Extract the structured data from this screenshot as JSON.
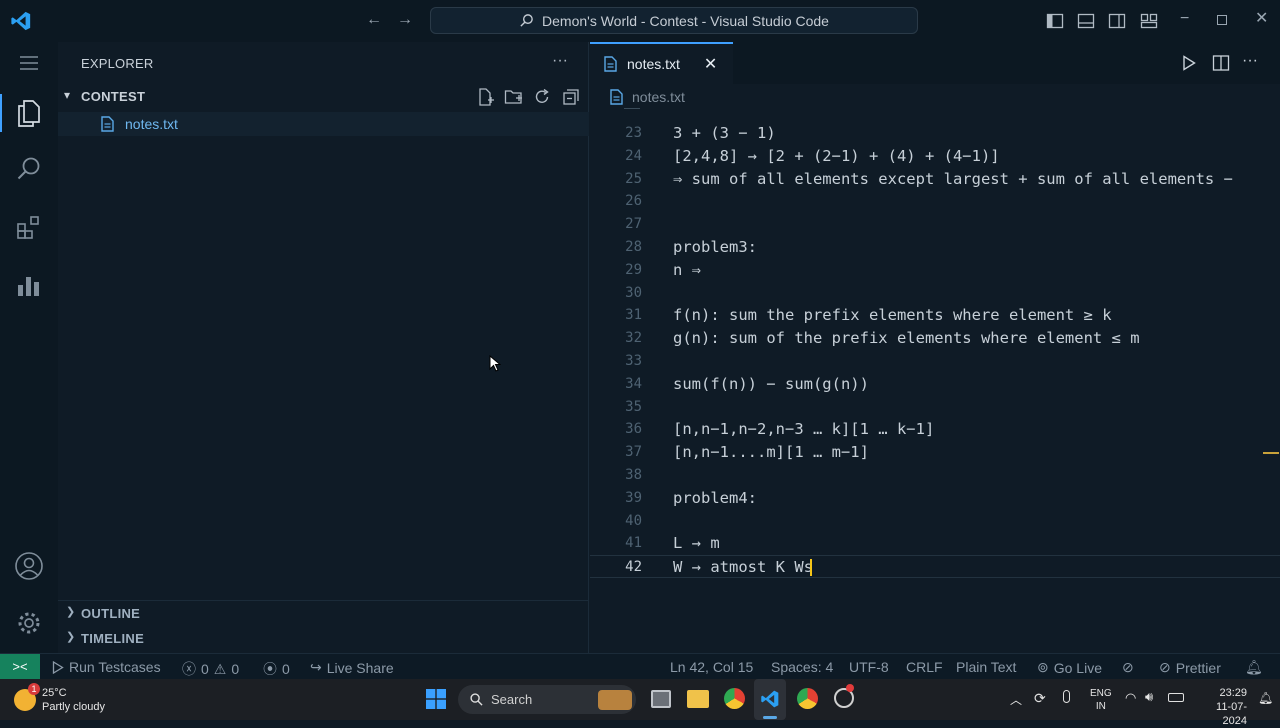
{
  "titlebar": {
    "title": "Demon's World - Contest - Visual Studio Code"
  },
  "sidebar": {
    "title": "EXPLORER",
    "more": "···",
    "folder": "CONTEST",
    "files": [
      {
        "name": "notes.txt"
      }
    ],
    "outline": "OUTLINE",
    "timeline": "TIMELINE"
  },
  "editor": {
    "tab_label": "notes.txt",
    "breadcrumb": "notes.txt",
    "lines": [
      {
        "n": "23",
        "text": "3 + (3 − 1)"
      },
      {
        "n": "24",
        "text": "[2,4,8] → [2 + (2−1) + (4) + (4−1)]"
      },
      {
        "n": "25",
        "text": "⇒ sum of all elements except largest + sum of all elements −"
      },
      {
        "n": "26",
        "text": ""
      },
      {
        "n": "27",
        "text": ""
      },
      {
        "n": "28",
        "text": "problem3:"
      },
      {
        "n": "29",
        "text": "n ⇒"
      },
      {
        "n": "30",
        "text": ""
      },
      {
        "n": "31",
        "text": "f(n): sum the prefix elements where element ≥ k"
      },
      {
        "n": "32",
        "text": "g(n): sum of the prefix elements where element ≤ m"
      },
      {
        "n": "33",
        "text": ""
      },
      {
        "n": "34",
        "text": "sum(f(n)) − sum(g(n))"
      },
      {
        "n": "35",
        "text": ""
      },
      {
        "n": "36",
        "text": "[n,n−1,n−2,n−3 … k][1 … k−1]"
      },
      {
        "n": "37",
        "text": "[n,n−1....m][1 … m−1]"
      },
      {
        "n": "38",
        "text": ""
      },
      {
        "n": "39",
        "text": "problem4:"
      },
      {
        "n": "40",
        "text": ""
      },
      {
        "n": "41",
        "text": "L → m"
      },
      {
        "n": "42",
        "text": "W → atmost K Ws"
      }
    ],
    "current_line": "42"
  },
  "statusbar": {
    "run_testcases": "Run Testcases",
    "errors": "0",
    "warnings": "0",
    "ports": "0",
    "live_share": "Live Share",
    "position": "Ln 42, Col 15",
    "spaces": "Spaces: 4",
    "encoding": "UTF-8",
    "eol": "CRLF",
    "language": "Plain Text",
    "go_live": "Go Live",
    "prettier": "Prettier"
  },
  "taskbar": {
    "weather_temp": "25°C",
    "weather_desc": "Partly cloudy",
    "weather_badge": "1",
    "search_label": "Search",
    "lang_top": "ENG",
    "lang_bottom": "IN",
    "time": "23:29",
    "date": "11-07-2024"
  },
  "colors": {
    "accent": "#3fa0ff",
    "file_icon": "#5aa8e6",
    "remote": "#16825d",
    "cursor": "#f5c518"
  }
}
